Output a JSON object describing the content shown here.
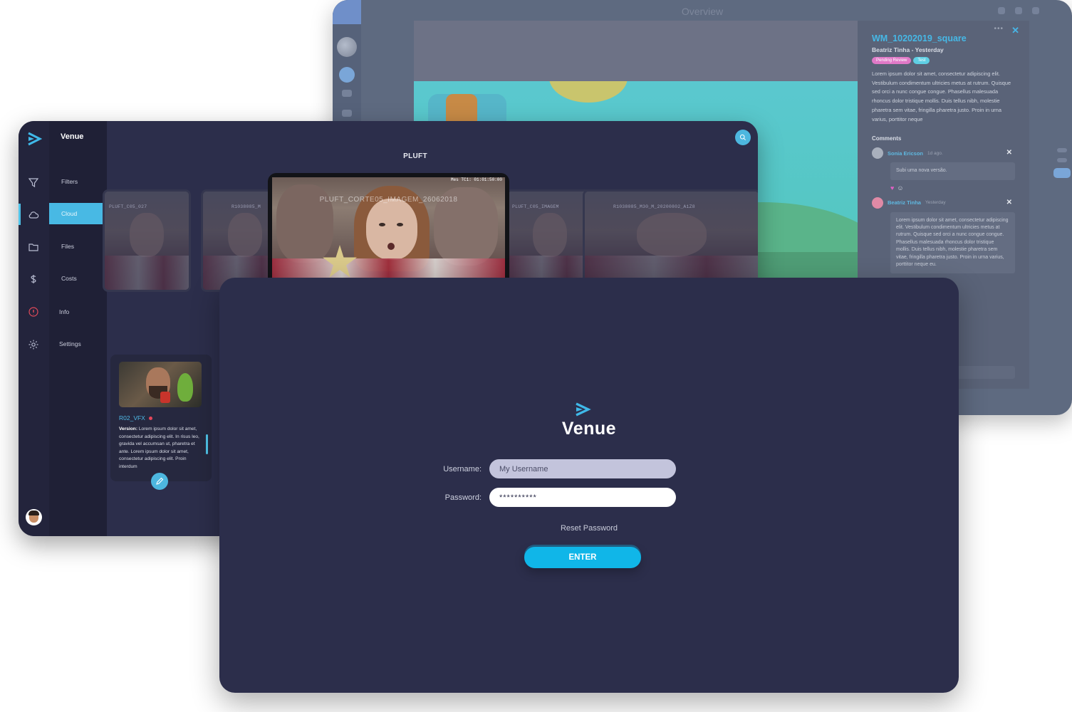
{
  "back_window": {
    "title": "Overview",
    "panel": {
      "asset_title": "WM_10202019_square",
      "meta": "Beatriz Tinha - Yesterday",
      "tags": [
        "Pending Review",
        "Test"
      ],
      "description": "Lorem ipsum dolor sit amet, consectetur adipiscing elit. Vestibulum condimentum ultricies metus at rutrum. Quisque sed orci a nunc congue congue. Phasellus malesuada rhoncus dolor tristique mollis. Duis tellus nibh, molestie pharetra sem vitae, fringilla pharetra justo. Proin in urna varius, porttitor neque",
      "comments_heading": "Comments",
      "comments": [
        {
          "name": "Sonia Ericson",
          "time": "1d ago.",
          "text": "Subi uma nova versão."
        },
        {
          "name": "Beatriz Tinha",
          "time": "Yesterday",
          "text": "Lorem ipsum dolor sit amet, consectetur adipiscing elit. Vestibulum condimentum ultricies metus at rutrum. Quisque sed orci a nunc congue congue. Phasellus malesuada rhoncus dolor tristique mollis. Duis tellus nibh, molestie pharetra sem vitae, fringilla pharetra justo. Proin in urna varius, porttitor neque eu."
        }
      ]
    }
  },
  "mid_window": {
    "brand": "Venue",
    "project_title": "PLUFT",
    "menu": [
      {
        "label": "Filters",
        "icon": "filter-icon"
      },
      {
        "label": "Cloud",
        "icon": "cloud-icon",
        "active": true
      },
      {
        "label": "Files",
        "icon": "folder-icon"
      },
      {
        "label": "Costs",
        "icon": "dollar-icon"
      },
      {
        "label": "Info",
        "icon": "info-icon"
      },
      {
        "label": "Settings",
        "icon": "gear-icon"
      }
    ],
    "featured": {
      "timecode": "Mes TC1: 01:01:50:00",
      "watermark": "PLUFT_CORTE05_IMAGEM_26062018"
    },
    "thumbs": [
      {
        "label": "PLUFT_C05_027"
      },
      {
        "label": "R1038085_M"
      },
      {
        "label": "PLUFT_C05_IMAGEM"
      },
      {
        "label": "R1038085_M30_M_20200802_A1Z8"
      }
    ],
    "card": {
      "title": "R02_VFX",
      "version_label": "Version:",
      "version_text": "Lorem ipsum dolor sit amet, consectetur adipiscing elit. In risus leo, gravida vel accumsan ut, pharetra et ante. Lorem ipsum dolor sit amet, consectetur adipiscing elit. Proin interdum"
    }
  },
  "login": {
    "brand": "Venue",
    "username_label": "Username:",
    "username_value": "My Username",
    "password_label": "Password:",
    "password_value": "**********",
    "reset_link": "Reset Password",
    "enter_button": "ENTER"
  },
  "colors": {
    "accent": "#10b6e8",
    "panel_dark": "#2c2e4b",
    "menu_active": "#48b9e4",
    "tag_pink": "#e079c7",
    "tag_cyan": "#5fcfe4"
  }
}
